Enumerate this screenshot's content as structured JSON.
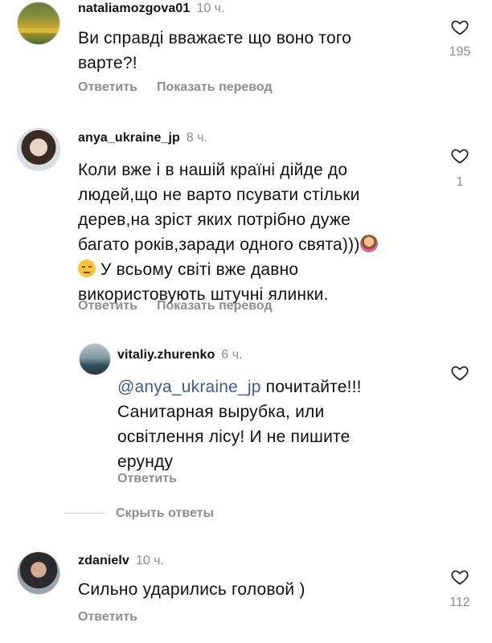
{
  "comments": [
    {
      "username": "nataliamozgova01",
      "time": "10 ч.",
      "lines": [
        "Ви справді вважаєте що воно того",
        "варте?!"
      ],
      "reply_label": "Ответить",
      "translate_label": "Показать перевод",
      "likes": "195"
    },
    {
      "username": "anya_ukraine_jp",
      "time": "8 ч.",
      "lines": [
        "Коли вже і в нашій країні дійде до",
        "людей,що не варто псувати стільки",
        "дерев,на зріст яких потрібно дуже",
        "багато років,заради одного свята)))",
        "У всьому світі вже давно",
        "використовують штучні ялинки."
      ],
      "reply_label": "Ответить",
      "translate_label": "Показать перевод",
      "likes": "1"
    },
    {
      "username": "vitaliy.zhurenko",
      "time": "6 ч.",
      "mention": "@anya_ukraine_jp",
      "lines": [
        " почитайте!!!",
        "Санитарная вырубка, или",
        "освітлення лісу! И не пишите",
        "ерунду"
      ],
      "reply_label": "Ответить"
    },
    {
      "username": "zdanielv",
      "time": "10 ч.",
      "lines": [
        "Сильно ударились головой )"
      ],
      "reply_label": "Ответить",
      "likes": "112"
    }
  ],
  "hide_replies_label": "Скрыть ответы",
  "icons": {
    "heart": "heart-outline-icon",
    "emoji_shrug": "woman-shrugging-emoji",
    "emoji_unamused": "unamused-face-emoji"
  },
  "colors": {
    "text": "#111111",
    "muted": "#8e8e8e",
    "mention": "#3b5d9c"
  }
}
